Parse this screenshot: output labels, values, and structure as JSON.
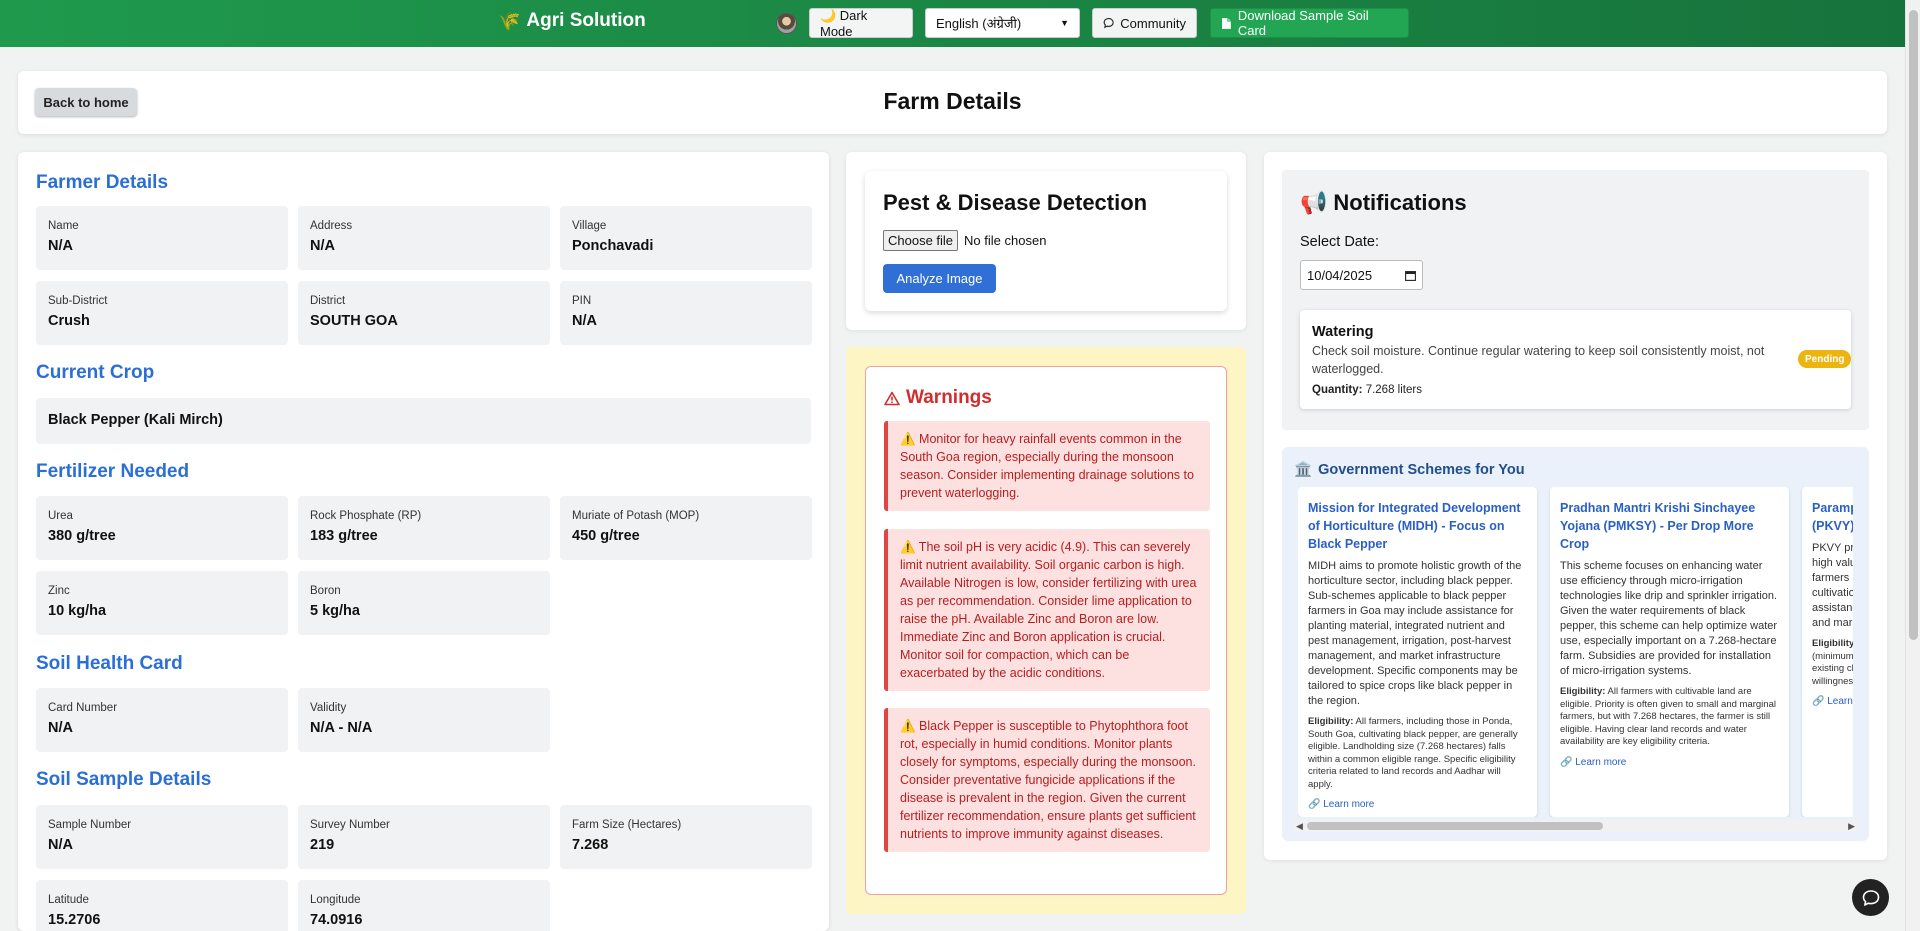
{
  "topbar": {
    "brand_icon": "wheat-icon",
    "brand": "Agri Solution",
    "dark_mode": "🌙 Dark Mode",
    "language": "English (अंग्रेजी)",
    "community": "Community",
    "download": "Download Sample Soil Card"
  },
  "header": {
    "back": "Back to home",
    "title": "Farm Details"
  },
  "farmer": {
    "title": "Farmer Details",
    "fields": [
      {
        "label": "Name",
        "value": "N/A"
      },
      {
        "label": "Address",
        "value": "N/A"
      },
      {
        "label": "Village",
        "value": "Ponchavadi"
      },
      {
        "label": "Sub-District",
        "value": "Crush"
      },
      {
        "label": "District",
        "value": "SOUTH GOA"
      },
      {
        "label": "PIN",
        "value": "N/A"
      }
    ]
  },
  "crop": {
    "title": "Current Crop",
    "value": "Black Pepper (Kali Mirch)"
  },
  "fertilizer": {
    "title": "Fertilizer Needed",
    "fields": [
      {
        "label": "Urea",
        "value": "380 g/tree"
      },
      {
        "label": "Rock Phosphate (RP)",
        "value": "183 g/tree"
      },
      {
        "label": "Muriate of Potash (MOP)",
        "value": "450 g/tree"
      },
      {
        "label": "Zinc",
        "value": "10 kg/ha"
      },
      {
        "label": "Boron",
        "value": "5 kg/ha"
      }
    ]
  },
  "soil_card": {
    "title": "Soil Health Card",
    "fields": [
      {
        "label": "Card Number",
        "value": "N/A"
      },
      {
        "label": "Validity",
        "value": "N/A - N/A"
      }
    ]
  },
  "sample": {
    "title": "Soil Sample Details",
    "fields": [
      {
        "label": "Sample Number",
        "value": "N/A"
      },
      {
        "label": "Survey Number",
        "value": "219"
      },
      {
        "label": "Farm Size (Hectares)",
        "value": "7.268"
      },
      {
        "label": "Latitude",
        "value": "15.2706"
      },
      {
        "label": "Longitude",
        "value": "74.0916"
      }
    ]
  },
  "pest": {
    "title": "Pest & Disease Detection",
    "choose_file": "Choose file",
    "no_file": "No file chosen",
    "analyze": "Analyze Image"
  },
  "warnings": {
    "title": "Warnings",
    "items": [
      "⚠️ Monitor for heavy rainfall events common in the South Goa region, especially during the monsoon season. Consider implementing drainage solutions to prevent waterlogging.",
      "⚠️ The soil pH is very acidic (4.9). This can severely limit nutrient availability. Soil organic carbon is high. Available Nitrogen is low, consider fertilizing with urea as per recommendation. Consider lime application to raise the pH. Available Zinc and Boron are low. Immediate Zinc and Boron application is crucial. Monitor soil for compaction, which can be exacerbated by the acidic conditions.",
      "⚠️ Black Pepper is susceptible to Phytophthora foot rot, especially in humid conditions. Monitor plants closely for symptoms, especially during the monsoon. Consider preventative fungicide applications if the disease is prevalent in the region. Given the current fertilizer recommendation, ensure plants get sufficient nutrients to improve immunity against diseases."
    ]
  },
  "notifications": {
    "icon": "📢",
    "title": "Notifications",
    "select_label": "Select Date:",
    "date": "10/04/2025",
    "task": {
      "title": "Watering",
      "desc": "Check soil moisture. Continue regular watering to keep soil consistently moist, not waterlogged.",
      "qty_label": "Quantity:",
      "qty": "7.268 liters",
      "status": "Pending"
    }
  },
  "schemes": {
    "icon": "🏛️",
    "title": "Government Schemes for You",
    "eligibility_label": "Eligibility:",
    "learn_more": "🔗 Learn more",
    "items": [
      {
        "title": "Mission for Integrated Development of Horticulture (MIDH) - Focus on Black Pepper",
        "desc": "MIDH aims to promote holistic growth of the horticulture sector, including black pepper. Sub-schemes applicable to black pepper farmers in Goa may include assistance for planting material, integrated nutrient and pest management, irrigation, post-harvest management, and market infrastructure development. Specific components may be tailored to spice crops like black pepper in the region.",
        "eligibility": "All farmers, including those in Ponda, South Goa, cultivating black pepper, are generally eligible. Landholding size (7.268 hectares) falls within a common eligible range. Specific eligibility criteria related to land records and Aadhar will apply."
      },
      {
        "title": "Pradhan Mantri Krishi Sinchayee Yojana (PMKSY) - Per Drop More Crop",
        "desc": "This scheme focuses on enhancing water use efficiency through micro-irrigation technologies like drip and sprinkler irrigation. Given the water requirements of black pepper, this scheme can help optimize water use, especially important on a 7.268-hectare farm. Subsidies are provided for installation of micro-irrigation systems.",
        "eligibility": "All farmers with cultivable land are eligible. Priority is often given to small and marginal farmers, but with 7.268 hectares, the farmer is still eligible. Having clear land records and water availability are key eligibility criteria."
      },
      {
        "title": "Paramparagat Krishi Vikas Yojana (PKVY)",
        "desc": "PKVY promotes organic farming. Given the high value of organically grown spices, farmers in Ponda can benefit from organic cultivation of black pepper. PKVY provides assistance for cluster formation, certification and marketing.",
        "eligibility": "Farmers willing to adopt organic farming (minimum cluster size requirements), can join existing clusters. Land ownership records and willingness to adopt organic farming required."
      }
    ]
  }
}
